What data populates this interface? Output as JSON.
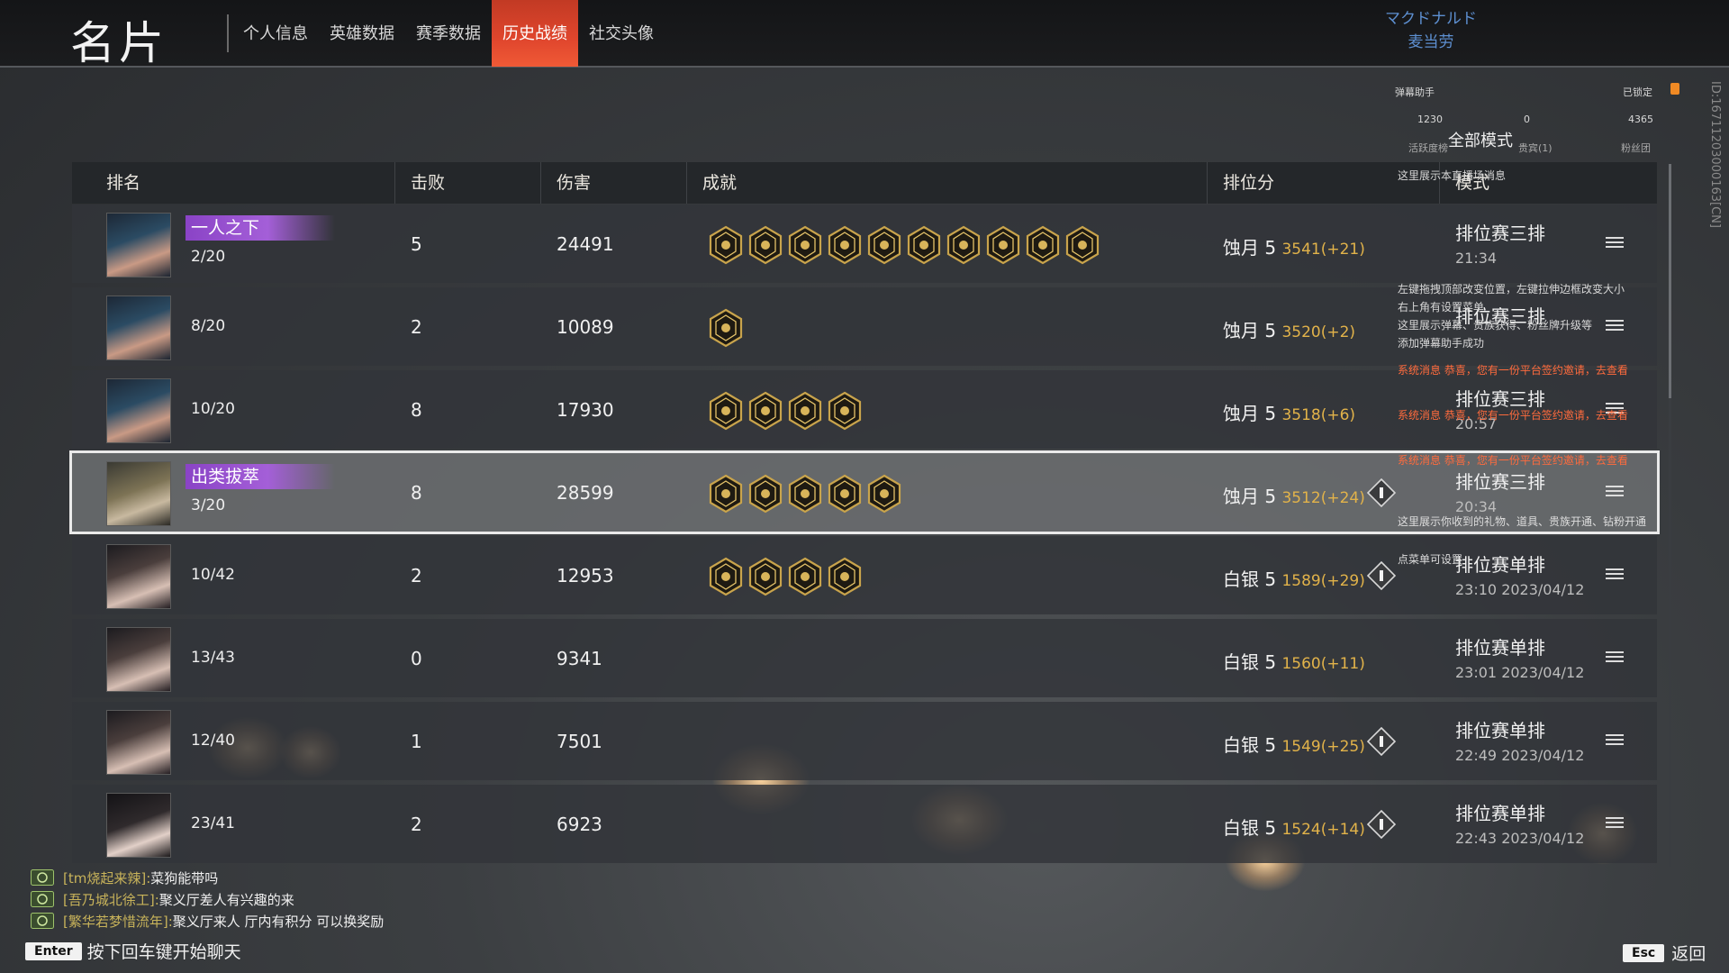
{
  "header": {
    "title": "名片",
    "tabs": [
      {
        "label": "个人信息",
        "active": false
      },
      {
        "label": "英雄数据",
        "active": false
      },
      {
        "label": "赛季数据",
        "active": false
      },
      {
        "label": "历史战绩",
        "active": true
      },
      {
        "label": "社交头像",
        "active": false
      }
    ],
    "brand_line1": "マクドナルド",
    "brand_line2": "麦当劳",
    "side_id": "ID:1671120300016​3[CN]"
  },
  "danmu": {
    "title": "弹幕助手",
    "lock_label": "已锁定",
    "stats": {
      "activity": "1230",
      "friends": "0",
      "fans": "4365"
    },
    "stat_labels": {
      "activity": "活跃度榜",
      "friends": "贵宾(1)",
      "fans": "粉丝团"
    },
    "mode_label": "全部模式",
    "messages": [
      "这里展示本直播场消息",
      "左键拖拽顶部改变位置，左键拉伸边框改变大小",
      "右上角有设置菜单",
      "这里展示弹幕、贵族获得、粉丝牌升级等",
      "添加弹幕助手成功",
      "系统消息  恭喜，您有一份平台签约邀请，去查看",
      "系统消息  恭喜，您有一份平台签约邀请，去查看",
      "系统消息  恭喜，您有一份平台签约邀请，去查看",
      "这里展示你收到的礼物、道具、贵族开通、钻粉开通",
      "点菜单可设置"
    ]
  },
  "table": {
    "headers": {
      "rank": "排名",
      "kills": "击败",
      "damage": "伤害",
      "achievements": "成就",
      "score": "排位分",
      "mode": "模式"
    },
    "rows": [
      {
        "title": "一人之下",
        "rank": "2/20",
        "kills": "5",
        "damage": "24491",
        "achievements": 10,
        "tier": "蚀月 5",
        "score": "3541(+21)",
        "rank_icon": false,
        "mode": "排位赛三排",
        "time": "21:34",
        "avatar": "av-a"
      },
      {
        "title": "",
        "rank": "8/20",
        "kills": "2",
        "damage": "10089",
        "achievements": 1,
        "tier": "蚀月 5",
        "score": "3520(+2)",
        "rank_icon": false,
        "mode": "排位赛三排",
        "time": "",
        "avatar": "av-a"
      },
      {
        "title": "",
        "rank": "10/20",
        "kills": "8",
        "damage": "17930",
        "achievements": 4,
        "tier": "蚀月 5",
        "score": "3518(+6)",
        "rank_icon": false,
        "mode": "排位赛三排",
        "time": "20:57",
        "avatar": "av-a"
      },
      {
        "title": "出类拔萃",
        "rank": "3/20",
        "kills": "8",
        "damage": "28599",
        "achievements": 5,
        "tier": "蚀月 5",
        "score": "3512(+24)",
        "rank_icon": true,
        "mode": "排位赛三排",
        "time": "20:34",
        "avatar": "av-b",
        "selected": true
      },
      {
        "title": "",
        "rank": "10/42",
        "kills": "2",
        "damage": "12953",
        "achievements": 4,
        "tier": "白银 5",
        "score": "1589(+29)",
        "rank_icon": true,
        "mode": "排位赛单排",
        "time": "23:10  2023/04/12",
        "avatar": "av-c"
      },
      {
        "title": "",
        "rank": "13/43",
        "kills": "0",
        "damage": "9341",
        "achievements": 0,
        "tier": "白银 5",
        "score": "1560(+11)",
        "rank_icon": false,
        "mode": "排位赛单排",
        "time": "23:01  2023/04/12",
        "avatar": "av-c"
      },
      {
        "title": "",
        "rank": "12/40",
        "kills": "1",
        "damage": "7501",
        "achievements": 0,
        "tier": "白银 5",
        "score": "1549(+25)",
        "rank_icon": true,
        "mode": "排位赛单排",
        "time": "22:49  2023/04/12",
        "avatar": "av-c"
      },
      {
        "title": "",
        "rank": "23/41",
        "kills": "2",
        "damage": "6923",
        "achievements": 0,
        "tier": "白银 5",
        "score": "1524(+14)",
        "rank_icon": true,
        "mode": "排位赛单排",
        "time": "22:43  2023/04/12",
        "avatar": "av-d"
      }
    ]
  },
  "chat": {
    "lines": [
      {
        "name": "[tm烧起来辣]:",
        "text": "菜狗能带吗"
      },
      {
        "name": "[吾乃城北徐工]:",
        "text": "聚义厅差人有兴趣的来"
      },
      {
        "name": "[繁华若梦惜流年]:",
        "text": "聚义厅来人  厅内有积分  可以换奖励"
      }
    ],
    "enter_key": "Enter",
    "enter_hint": "按下回车键开始聊天",
    "esc_key": "Esc",
    "esc_hint": "返回"
  }
}
